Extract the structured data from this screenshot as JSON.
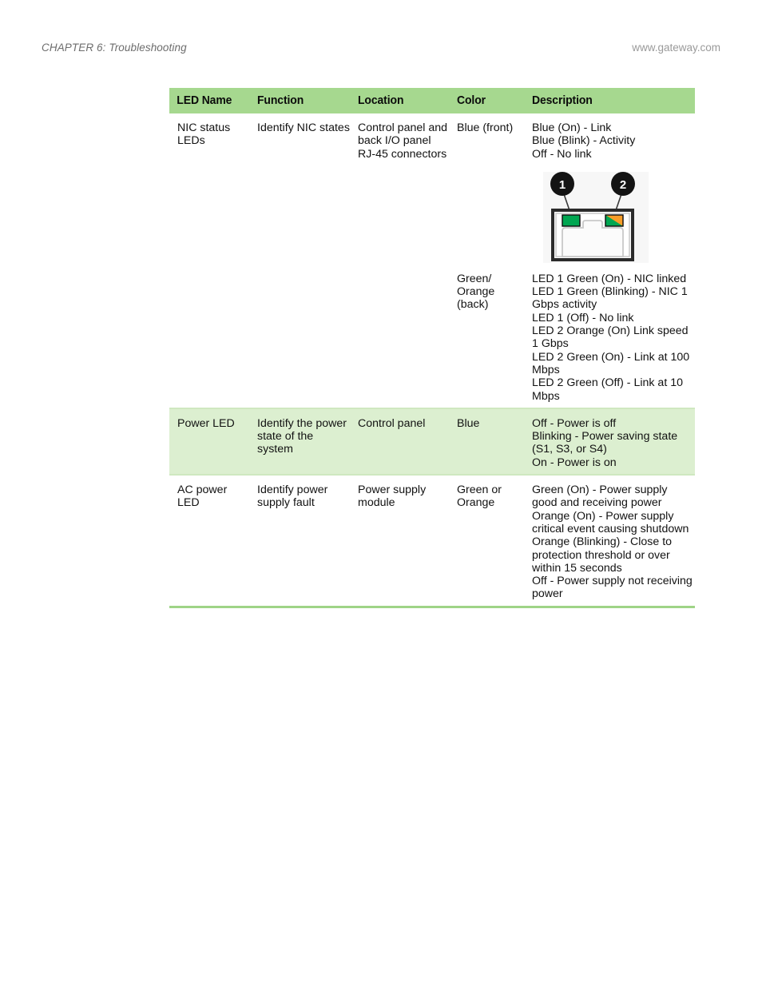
{
  "header": {
    "chapter": "CHAPTER 6: Troubleshooting",
    "url": "www.gateway.com"
  },
  "colors": {
    "header_green": "#A6D88F",
    "row_shade_green": "#DCEFD0",
    "rule_green": "#9FD487",
    "led_green": "#00A651",
    "led_orange": "#F79D28"
  },
  "table": {
    "columns": [
      {
        "key": "led_name",
        "label": "LED Name"
      },
      {
        "key": "function",
        "label": "Function"
      },
      {
        "key": "location",
        "label": "Location"
      },
      {
        "key": "color",
        "label": "Color"
      },
      {
        "key": "description",
        "label": "Description"
      }
    ],
    "rows": [
      {
        "led_name": "NIC status LEDs",
        "function": "Identify NIC states",
        "location": "Control panel and back I/O panel RJ-45 connectors",
        "color": "Blue (front)",
        "description": "Blue (On) - Link\nBlue (Blink) - Activity\nOff - No link",
        "shaded": false
      },
      {
        "led_name": "",
        "function": "",
        "location": "",
        "color": "Green/ Orange (back)",
        "description": "LED 1 Green (On) - NIC linked\nLED 1 Green (Blinking) - NIC 1 Gbps activity\nLED 1 (Off) - No link\nLED 2 Orange (On) Link speed 1 Gbps\nLED 2 Green (On) - Link at 100 Mbps\nLED 2 Green (Off) - Link at 10 Mbps",
        "shaded": false
      },
      {
        "led_name": "Power LED",
        "function": "Identify the power state of the system",
        "location": "Control panel",
        "color": "Blue",
        "description": "Off - Power is off\nBlinking - Power saving state (S1, S3, or S4)\nOn - Power is on",
        "shaded": true
      },
      {
        "led_name": "AC power LED",
        "function": "Identify power supply fault",
        "location": "Power supply module",
        "color": "Green or Orange",
        "description": "Green (On) - Power supply good and receiving power\nOrange (On) - Power supply critical event causing shutdown\nOrange (Blinking) - Close to protection threshold or over within 15 seconds\nOff - Power supply not receiving power",
        "shaded": false
      }
    ]
  },
  "figure": {
    "name": "rj45-connector-diagram",
    "callouts": [
      {
        "id": "1",
        "label": "1"
      },
      {
        "id": "2",
        "label": "2"
      }
    ]
  }
}
